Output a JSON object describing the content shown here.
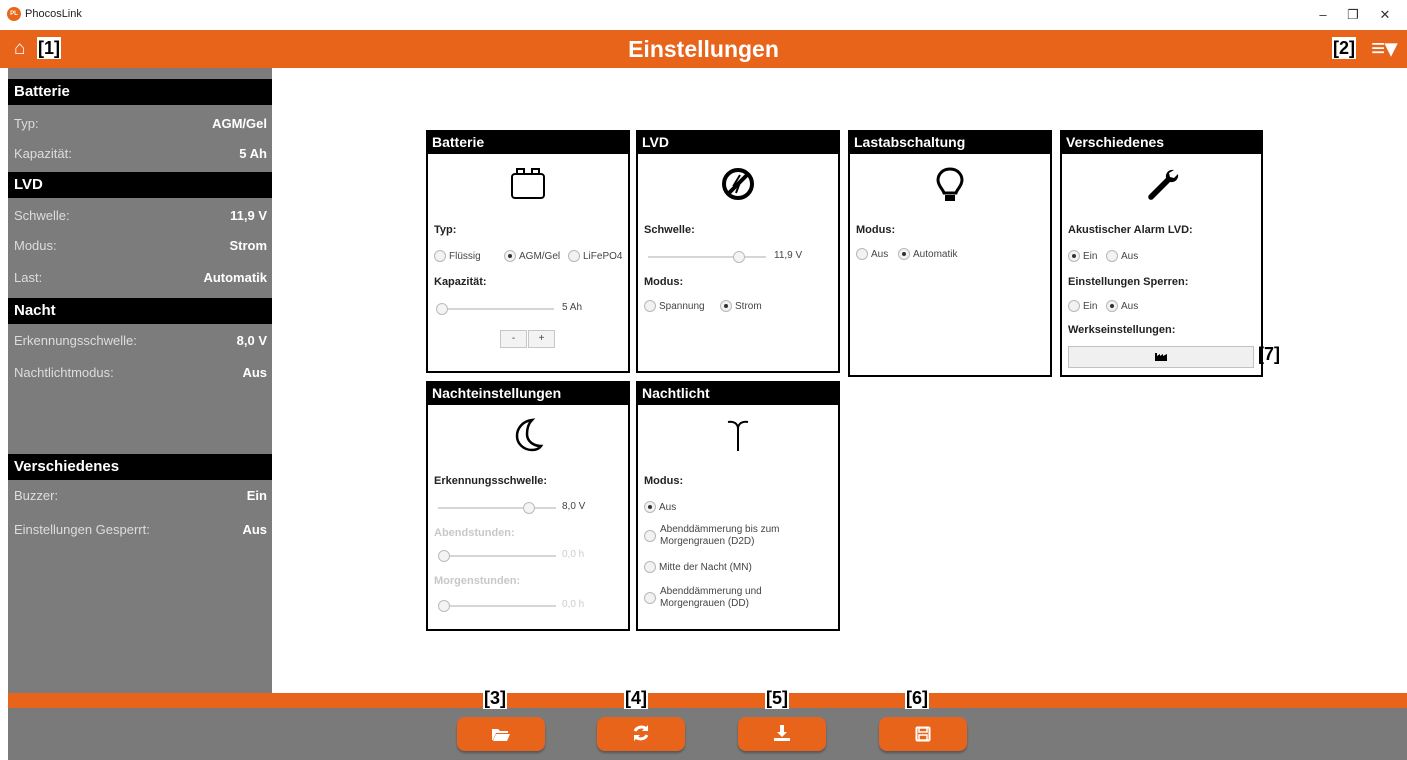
{
  "window": {
    "app_title": "PhocosLink",
    "logo_text": "PL",
    "minimize": "–",
    "restore": "❐",
    "close": "✕"
  },
  "header": {
    "home_icon": "⌂",
    "tag_home": "[1]",
    "title": "Einstellungen",
    "tag_menu": "[2]",
    "menu_icon": "≡▾"
  },
  "sidebar": {
    "batterie": {
      "title": "Batterie",
      "rows": [
        {
          "label": "Typ:",
          "value": "AGM/Gel"
        },
        {
          "label": "Kapazität:",
          "value": "5 Ah"
        }
      ]
    },
    "lvd": {
      "title": "LVD",
      "rows": [
        {
          "label": "Schwelle:",
          "value": "11,9  V"
        },
        {
          "label": "Modus:",
          "value": "Strom"
        },
        {
          "label": "Last:",
          "value": "Automatik"
        }
      ]
    },
    "nacht": {
      "title": "Nacht",
      "rows": [
        {
          "label": "Erkennungsschwelle:",
          "value": "8,0  V"
        },
        {
          "label": "Nachtlichtmodus:",
          "value": "Aus"
        }
      ]
    },
    "verschiedenes": {
      "title": "Verschiedenes",
      "rows": [
        {
          "label": "Buzzer:",
          "value": "Ein"
        },
        {
          "label": "Einstellungen Gesperrt:",
          "value": "Aus"
        }
      ]
    }
  },
  "panels": {
    "batterie": {
      "title": "Batterie",
      "icon": "battery-icon",
      "typ_label": "Typ:",
      "typ_options": [
        "Flüssig",
        "AGM/Gel",
        "LiFePO4"
      ],
      "typ_selected": "AGM/Gel",
      "kap_label": "Kapazität:",
      "kap_value": "5 Ah",
      "kap_fraction": 0.0,
      "minus": "-",
      "plus": "+"
    },
    "lvd": {
      "title": "LVD",
      "icon": "no-power-icon",
      "schwelle_label": "Schwelle:",
      "schwelle_value": "11,9  V",
      "schwelle_fraction": 0.8,
      "modus_label": "Modus:",
      "modus_options": [
        "Spannung",
        "Strom"
      ],
      "modus_selected": "Strom"
    },
    "last": {
      "title": "Lastabschaltung",
      "icon": "lightbulb-icon",
      "modus_label": "Modus:",
      "modus_options": [
        "Aus",
        "Automatik"
      ],
      "modus_selected": "Automatik"
    },
    "versch": {
      "title": "Verschiedenes",
      "icon": "wrench-icon",
      "alarm_label": "Akustischer Alarm LVD:",
      "alarm_options": [
        "Ein",
        "Aus"
      ],
      "alarm_selected": "Ein",
      "sperren_label": "Einstellungen Sperren:",
      "sperren_options": [
        "Ein",
        "Aus"
      ],
      "sperren_selected": "Aus",
      "werks_label": "Werkseinstellungen:",
      "werks_button_icon": "factory-icon",
      "tag": "[7]"
    },
    "nacht": {
      "title": "Nachteinstellungen",
      "icon": "moon-icon",
      "erk_label": "Erkennungsschwelle:",
      "erk_value": "8,0  V",
      "erk_fraction": 0.8,
      "abend_label": "Abendstunden:",
      "abend_value": "0,0  h",
      "abend_fraction": 0.0,
      "morgen_label": "Morgenstunden:",
      "morgen_value": "0,0  h",
      "morgen_fraction": 0.0
    },
    "nachtlicht": {
      "title": "Nachtlicht",
      "icon": "streetlight-icon",
      "modus_label": "Modus:",
      "options": [
        "Aus",
        "Abenddämmerung bis zum\nMorgengrauen (D2D)",
        "Mitte der Nacht (MN)",
        "Abenddämmerung und\nMorgengrauen (DD)"
      ],
      "selected": "Aus"
    }
  },
  "footer": {
    "buttons": [
      {
        "tag": "[3]",
        "icon": "folder-open-icon"
      },
      {
        "tag": "[4]",
        "icon": "refresh-icon"
      },
      {
        "tag": "[5]",
        "icon": "download-icon"
      },
      {
        "tag": "[6]",
        "icon": "save-icon"
      }
    ]
  },
  "colors": {
    "accent": "#e8641a",
    "sidebar": "#7c7c7c",
    "footer": "#7a7a7a"
  }
}
